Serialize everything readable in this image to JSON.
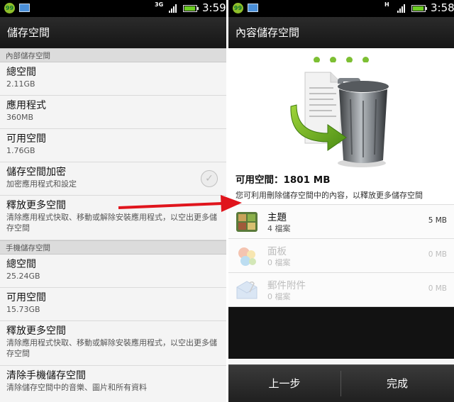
{
  "left": {
    "status": {
      "network": "3G",
      "time": "3:59",
      "notification_badge": "99"
    },
    "title": "儲存空間",
    "internal_section": {
      "header": "內部儲存空間",
      "items": [
        {
          "title": "總空間",
          "subtitle": "2.11GB"
        },
        {
          "title": "應用程式",
          "subtitle": "360MB"
        },
        {
          "title": "可用空間",
          "subtitle": "1.76GB"
        },
        {
          "title": "儲存空間加密",
          "subtitle": "加密應用程式和設定",
          "checkbox": "✓"
        },
        {
          "title": "釋放更多空間",
          "subtitle": "清除應用程式快取、移動或解除安裝應用程式，以空出更多儲存空間"
        }
      ]
    },
    "phone_section": {
      "header": "手機儲存空間",
      "items": [
        {
          "title": "總空間",
          "subtitle": "25.24GB"
        },
        {
          "title": "可用空間",
          "subtitle": "15.73GB"
        },
        {
          "title": "釋放更多空間",
          "subtitle": "清除應用程式快取、移動或解除安裝應用程式，以空出更多儲存空間"
        },
        {
          "title": "清除手機儲存空間",
          "subtitle": "清除儲存空間中的音樂、圖片和所有資料"
        }
      ]
    }
  },
  "right": {
    "status": {
      "network": "H",
      "time": "3:58",
      "notification_badge": "99"
    },
    "title": "內容儲存空間",
    "available_label": "可用空間：1801 MB",
    "description": "您可利用刪除儲存空間中的內容，以釋放更多儲存空間",
    "rows": [
      {
        "title": "主題",
        "count": "4 檔案",
        "size": "5 MB",
        "icon": "theme-icon"
      },
      {
        "title": "面板",
        "count": "0 檔案",
        "size": "0 MB",
        "icon": "skin-icon"
      },
      {
        "title": "郵件附件",
        "count": "0 檔案",
        "size": "0 MB",
        "icon": "mail-attachment-icon"
      }
    ],
    "buttons": {
      "back": "上一步",
      "done": "完成"
    }
  },
  "colors": {
    "accent_green": "#7dbf33",
    "arrow_red": "#e0141c"
  }
}
